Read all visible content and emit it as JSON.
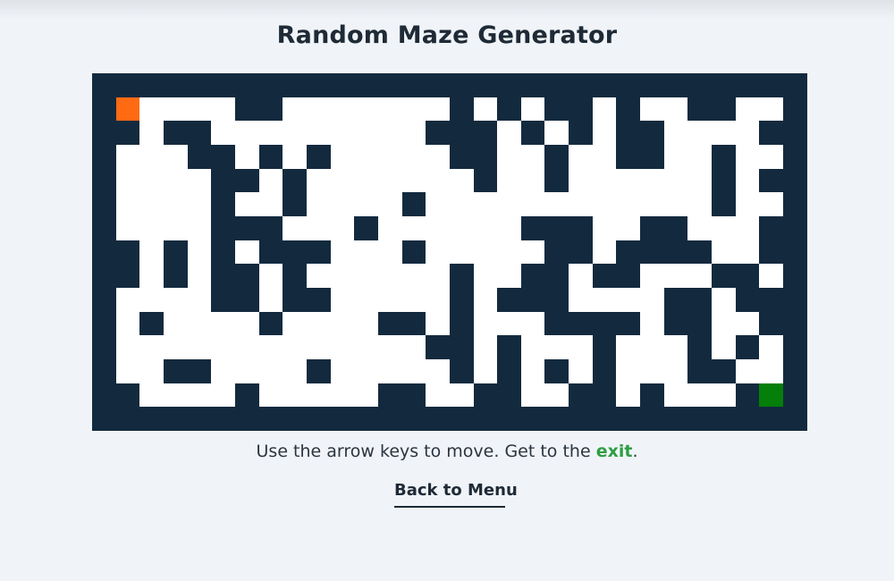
{
  "page": {
    "title": "Random Maze Generator",
    "instructions_prefix": "Use the arrow keys to move. Get to the ",
    "instructions_exit_word": "exit",
    "instructions_suffix": ".",
    "back_link": "Back to Menu"
  },
  "colors": {
    "wall": "#132a3e",
    "path": "#ffffff",
    "player": "#ff6a13",
    "exit": "#037f0a",
    "exit_text": "#2f9e44",
    "background": "#f0f4f8"
  },
  "maze": {
    "cols": 30,
    "rows": 15,
    "player": {
      "row": 1,
      "col": 1
    },
    "exit": {
      "row": 13,
      "col": 28
    },
    "grid": [
      "111111111111111111111111111111",
      "100000110000000101011010011001",
      "110110000000001110101011000011",
      "100011010100000110010011001001",
      "100001101000000010010000001011",
      "100001001000010000000000001001",
      "100001110001000000111001100011",
      "110101011100010000011011110011",
      "110101101000000100110110001101",
      "100001101100000101110000110111",
      "101000010000110100011110110011",
      "100000000000001101000100010101",
      "100110000100000101010100011001",
      "110000100000110011001101000101",
      "111111111111111111111111111111"
    ]
  }
}
